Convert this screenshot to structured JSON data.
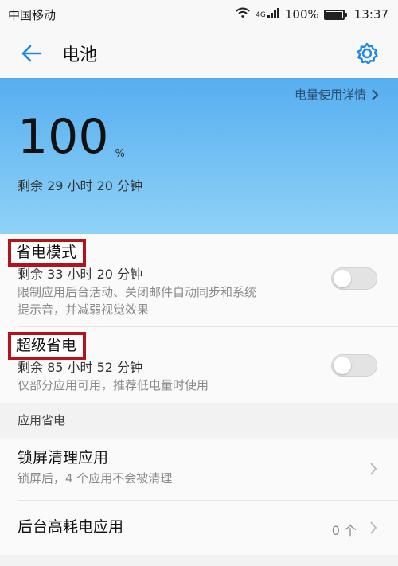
{
  "status_bar": {
    "carrier": "中国移动",
    "network": "4G",
    "battery_percent": "100%",
    "time": "13:37",
    "icons": [
      "wifi-icon",
      "signal-icon",
      "battery-icon"
    ]
  },
  "app_bar": {
    "title": "电池",
    "icons": {
      "back": "arrow-left-icon",
      "settings": "gear-icon"
    }
  },
  "hero": {
    "details_link": "电量使用详情",
    "level": "100",
    "unit": "%",
    "remaining": "剩余 29 小时 20 分钟"
  },
  "power_modes": [
    {
      "title": "省电模式",
      "meta": "剩余 33 小时 20 分钟",
      "desc_line1": "限制应用后台活动、关闭邮件自动同步和系统",
      "desc_line2": "提示音，并减弱视觉效果",
      "enabled": false
    },
    {
      "title": "超级省电",
      "meta": "剩余 85 小时 52 分钟",
      "desc_line1": "仅部分应用可用，推荐低电量时使用",
      "enabled": false
    }
  ],
  "app_saving": {
    "section_title": "应用省电",
    "items": [
      {
        "title": "锁屏清理应用",
        "subtitle": "锁屏后，4 个应用不会被清理"
      },
      {
        "title": "后台高耗电应用",
        "count": "0 个"
      }
    ]
  },
  "colors": {
    "accent": "#1e88e5",
    "hero_top": "#56aef0",
    "hero_bottom": "#8fd2f6",
    "highlight_frame": "#b5121b"
  }
}
